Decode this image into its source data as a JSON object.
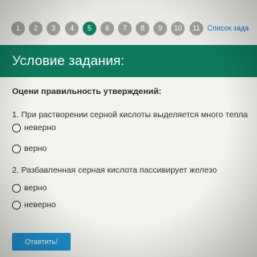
{
  "pagination": {
    "pages": [
      "1",
      "2",
      "3",
      "4",
      "5",
      "6",
      "7",
      "8",
      "9",
      "10",
      "11"
    ],
    "active_page": "5",
    "tasks_link": "Список зада"
  },
  "header": {
    "title": "Условие задания:"
  },
  "task": {
    "instruction": "Оцени правильность утверждений:",
    "questions": [
      {
        "text": "1. При растворении серной кислоты выделяется много тепла",
        "options": [
          "неверно",
          "верно"
        ]
      },
      {
        "text": "2. Разбавленная серная кислота пассивирует железо",
        "options": [
          "верно",
          "неверно"
        ]
      }
    ],
    "submit_label": "Ответить!"
  },
  "colors": {
    "accent_green": "#0d7a5e",
    "button_blue": "#1f93d2",
    "page_inactive": "#9b9b98",
    "link_blue": "#1a76c9"
  }
}
